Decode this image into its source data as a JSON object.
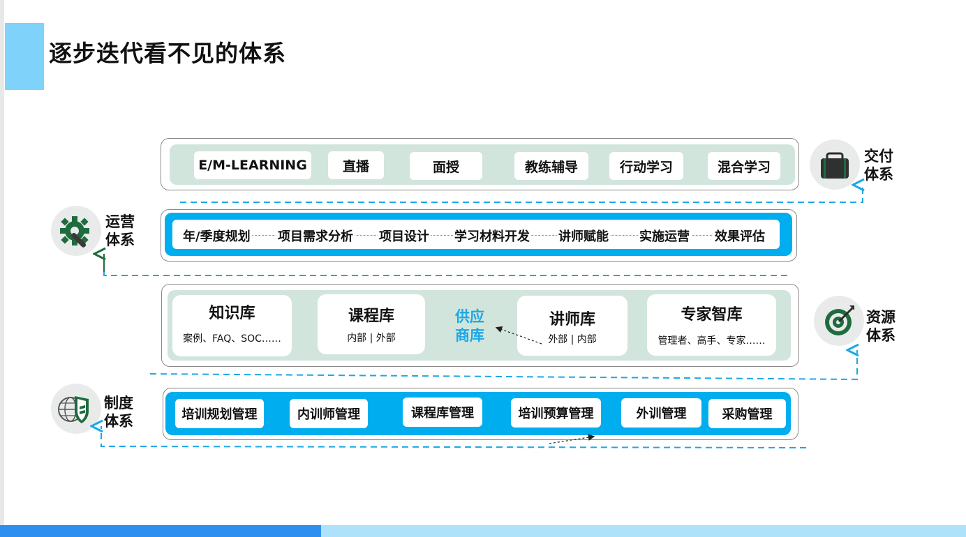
{
  "title": "逐步迭代看不见的体系",
  "delivery": {
    "label_line1": "交付",
    "label_line2": "体系",
    "icon": "briefcase-icon",
    "items": [
      "E/M-LEARNING",
      "直播",
      "面授",
      "教练辅导",
      "行动学习",
      "混合学习"
    ]
  },
  "operations": {
    "label_line1": "运营",
    "label_line2": "体系",
    "icon": "gear-wrench-icon",
    "steps": [
      "年/季度规划",
      "项目需求分析",
      "项目设计",
      "学习材料开发",
      "讲师赋能",
      "实施运营",
      "效果评估"
    ]
  },
  "resources": {
    "label_line1": "资源",
    "label_line2": "体系",
    "icon": "target-icon",
    "knowledge": {
      "title": "知识库",
      "sub": "案例、FAQ、SOC……"
    },
    "course": {
      "title": "课程库",
      "sub": "内部 | 外部"
    },
    "supply_line1": "供应",
    "supply_line2": "商库",
    "lecturer": {
      "title": "讲师库",
      "sub": "外部 | 内部"
    },
    "expert": {
      "title": "专家智库",
      "sub": "管理者、高手、专家……"
    }
  },
  "institution": {
    "label_line1": "制度",
    "label_line2": "体系",
    "icon": "shield-globe-icon",
    "items": [
      "培训规划管理",
      "内训师管理",
      "课程库管理",
      "培训预算管理",
      "外训管理",
      "采购管理"
    ]
  },
  "colors": {
    "accent_light_blue": "#7fd3fb",
    "bar_blue": "#00aef0",
    "panel_green": "#d2e5dd",
    "dashed_blue": "#1ca7e6",
    "icon_green": "#1f6b3e",
    "supply_text": "#1ca7e6"
  }
}
